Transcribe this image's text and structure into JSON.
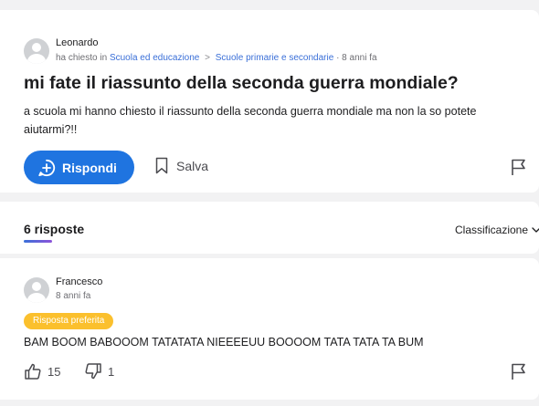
{
  "question": {
    "author": "Leonardo",
    "asked_label": "ha chiesto in",
    "category": "Scuola ed educazione",
    "subcategory": "Scuole primarie e secondarie",
    "age": "8 anni fa",
    "title": "mi fate il riassunto della seconda guerra mondiale?",
    "body": "a scuola mi hanno chiesto il riassunto della seconda guerra mondiale ma non la so potete aiutarmi?!!",
    "answer_button": "Rispondi",
    "save_button": "Salva"
  },
  "answers_header": {
    "count_label": "6 risposte",
    "sort_label": "Classificazione"
  },
  "answer": {
    "author": "Francesco",
    "age": "8 anni fa",
    "badge": "Risposta preferita",
    "text": "BAM BOOM BABOOOM TATATATA NIEEEEUU BOOOOM TATA TATA TA BUM",
    "upvotes": "15",
    "downvotes": "1"
  },
  "colors": {
    "primary": "#1f74e0",
    "badge": "#fbc02d",
    "link": "#3a6fd8"
  }
}
